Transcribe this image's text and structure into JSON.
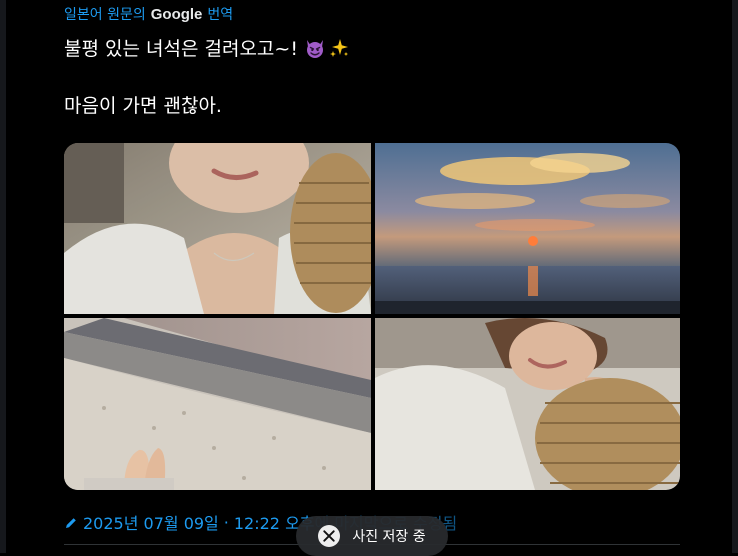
{
  "translation": {
    "prefix": "일본어 원문의",
    "provider": "Google",
    "suffix": "번역"
  },
  "tweet": {
    "line1": "불평 있는 녀석은 걸려오고~!",
    "line1_emojis": [
      "smiling-devil",
      "sparkles"
    ],
    "line2": "마음이 가면 괜찮아."
  },
  "media": {
    "photos": [
      {
        "label": "selfie-white-shirt-straw-bag"
      },
      {
        "label": "ocean-sunset"
      },
      {
        "label": "sandy-beach-feet"
      },
      {
        "label": "smiling-selfie-car"
      }
    ]
  },
  "meta": {
    "date": "2025년 07월 09일",
    "separator": "·",
    "time": "12:22 오후",
    "edited_text": "에 마지막으로 수정됨"
  },
  "toast": {
    "label": "사진 저장 중"
  },
  "colors": {
    "accent": "#1d9bf0",
    "background": "#000000",
    "text": "#e7e9ea"
  }
}
